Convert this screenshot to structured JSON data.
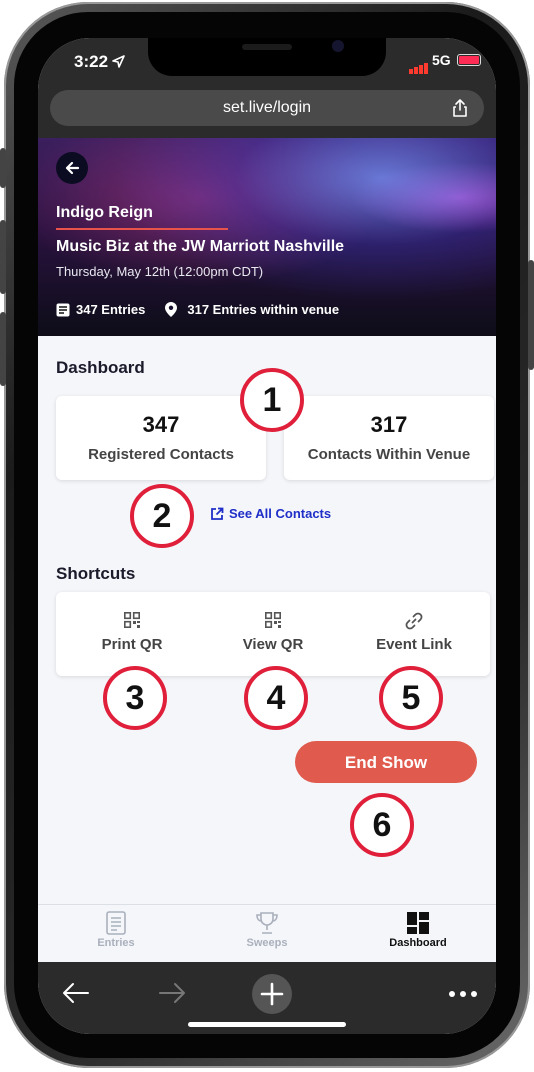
{
  "status_bar": {
    "time": "3:22",
    "network": "5G"
  },
  "browser": {
    "url": "set.live/login"
  },
  "hero": {
    "artist": "Indigo Reign",
    "event_title": "Music Biz at the JW Marriott Nashville",
    "event_date": "Thursday, May 12th (12:00pm CDT)",
    "entries_label": "347 Entries",
    "venue_label": "317  Entries within venue"
  },
  "dashboard": {
    "heading": "Dashboard",
    "registered_count": "347",
    "registered_label": "Registered Contacts",
    "venue_count": "317",
    "venue_label": "Contacts Within Venue",
    "see_all_label": "See All Contacts"
  },
  "shortcuts": {
    "heading": "Shortcuts",
    "items": [
      {
        "label": "Print QR",
        "icon": "qr-code-icon"
      },
      {
        "label": "View QR",
        "icon": "qr-code-icon"
      },
      {
        "label": "Event Link",
        "icon": "link-icon"
      }
    ]
  },
  "end_show_label": "End Show",
  "callouts": [
    "1",
    "2",
    "3",
    "4",
    "5",
    "6"
  ],
  "callout_color": "#e0203a",
  "accent_color": "#e05a4e",
  "link_color": "#1f2fc8",
  "tabs": [
    {
      "label": "Entries",
      "icon": "document-icon",
      "active": false
    },
    {
      "label": "Sweeps",
      "icon": "trophy-icon",
      "active": false
    },
    {
      "label": "Dashboard",
      "icon": "dashboard-icon",
      "active": true
    }
  ]
}
